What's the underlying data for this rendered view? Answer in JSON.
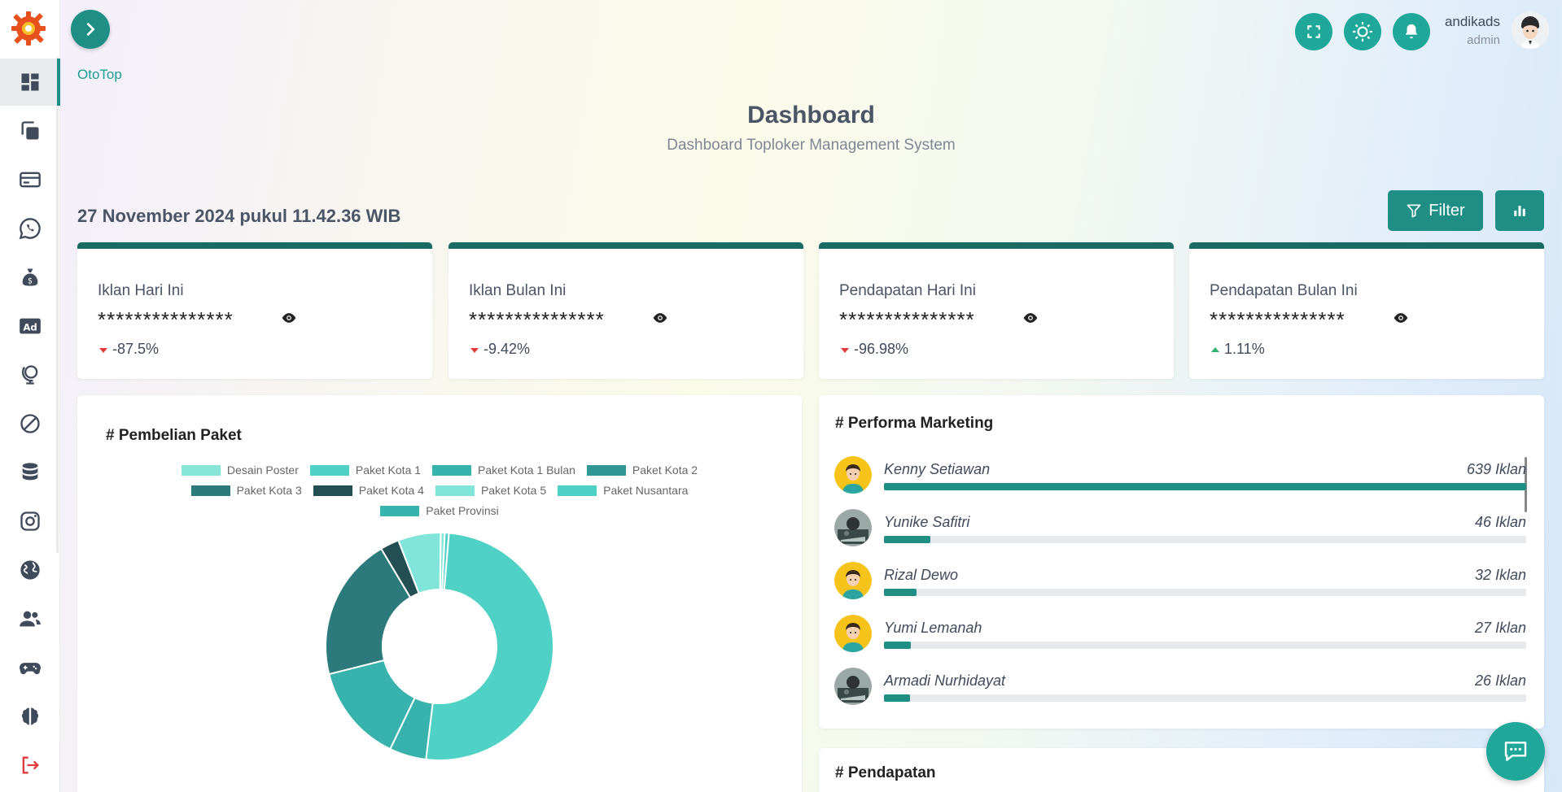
{
  "app": {
    "breadcrumb": "OtoTop"
  },
  "header": {
    "title": "Dashboard",
    "subtitle": "Dashboard Toploker Management System"
  },
  "user": {
    "name": "andikads",
    "role": "admin"
  },
  "sidebar": {
    "items": [
      {
        "icon": "dashboard-icon",
        "active": true
      },
      {
        "icon": "copy-icon"
      },
      {
        "icon": "credit-card-icon"
      },
      {
        "icon": "whatsapp-icon"
      },
      {
        "icon": "money-bag-icon"
      },
      {
        "icon": "ad-icon"
      },
      {
        "icon": "globe-stand-icon"
      },
      {
        "icon": "ban-icon"
      },
      {
        "icon": "database-icon"
      },
      {
        "icon": "instagram-icon"
      },
      {
        "icon": "earth-icon"
      },
      {
        "icon": "users-icon"
      },
      {
        "icon": "gamepad-icon"
      },
      {
        "icon": "brain-icon"
      },
      {
        "icon": "logout-icon"
      }
    ]
  },
  "toolbar": {
    "datetime": "27 November 2024 pukul 11.42.36 WIB",
    "filter_label": "Filter"
  },
  "stats": [
    {
      "label": "Iklan Hari Ini",
      "masked": "***************",
      "change": "-87.5%",
      "trend": "down"
    },
    {
      "label": "Iklan Bulan Ini",
      "masked": "***************",
      "change": "-9.42%",
      "trend": "down"
    },
    {
      "label": "Pendapatan Hari Ini",
      "masked": "***************",
      "change": "-96.98%",
      "trend": "down"
    },
    {
      "label": "Pendapatan Bulan Ini",
      "masked": "***************",
      "change": "1.11%",
      "trend": "up"
    }
  ],
  "pembelian": {
    "title": "# Pembelian Paket"
  },
  "chart_data": {
    "type": "pie",
    "title": "# Pembelian Paket",
    "categories": [
      "Desain Poster",
      "Paket Kota 1",
      "Paket Kota 1 Bulan",
      "Paket Kota 2",
      "Paket Kota 3",
      "Paket Kota 4",
      "Paket Kota 5",
      "Paket Nusantara",
      "Paket Provinsi"
    ],
    "values": [
      0.5,
      0.5,
      12,
      0,
      17.5,
      2.3,
      5.2,
      43.5,
      4.5
    ],
    "colors": [
      "#88e6d9",
      "#4fd1c5",
      "#38b2ac",
      "#319795",
      "#2c7a7b",
      "#234e52",
      "#81e6d9",
      "#4fd1c5",
      "#38b2ac"
    ],
    "legend_position": "top",
    "donut": true
  },
  "marketing": {
    "title": "# Performa Marketing",
    "rows": [
      {
        "name": "Kenny Setiawan",
        "count": "639 Iklan",
        "value": 639,
        "avatar": "cartoon"
      },
      {
        "name": "Yunike Safitri",
        "count": "46 Iklan",
        "value": 46,
        "avatar": "photo"
      },
      {
        "name": "Rizal Dewo",
        "count": "32 Iklan",
        "value": 32,
        "avatar": "cartoon"
      },
      {
        "name": "Yumi Lemanah",
        "count": "27 Iklan",
        "value": 27,
        "avatar": "cartoon"
      },
      {
        "name": "Armadi Nurhidayat",
        "count": "26 Iklan",
        "value": 26,
        "avatar": "photo"
      }
    ],
    "max": 639
  },
  "pendapatan": {
    "title": "# Pendapatan"
  }
}
